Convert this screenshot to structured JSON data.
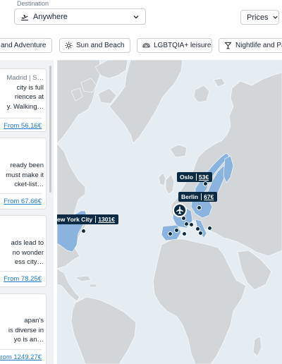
{
  "search": {
    "destination_label": "Destination",
    "destination_value": "Anywhere",
    "prices_label": "Prices"
  },
  "categories": [
    {
      "label": "and Adventure",
      "icon": "none"
    },
    {
      "label": "Sun and Beach",
      "icon": "sun-icon"
    },
    {
      "label": "LGBTQIA+ leisure",
      "icon": "lgbtqia-icon"
    },
    {
      "label": "Nightlife and Pa",
      "icon": "cocktail-icon"
    }
  ],
  "cards": [
    {
      "lines": [
        "Madrid | S…",
        "city is full",
        "riences at",
        "y. Walking…"
      ],
      "from": "From 56.16€"
    },
    {
      "lines": [
        "ready been",
        "must make it",
        "cket-list…"
      ],
      "from": "From 67.66€"
    },
    {
      "lines": [
        "ads lead to",
        "no wonder",
        "ess city…"
      ],
      "from": "From 78.25€"
    },
    {
      "lines": [
        "apan's",
        "is diverse in",
        "yo is an…"
      ],
      "from": "From 1249.27€"
    }
  ],
  "map": {
    "pins": [
      {
        "city": "Oslo",
        "price": "53€"
      },
      {
        "city": "Berlin",
        "price": "67€"
      },
      {
        "city": "ew York City",
        "price": "1301€"
      }
    ],
    "colors": {
      "ocean": "#e6edf2",
      "land": "#d3d6d9",
      "highlight": "#8ab4dd",
      "pin": "#0b2b45",
      "link": "#1c78c8"
    }
  }
}
